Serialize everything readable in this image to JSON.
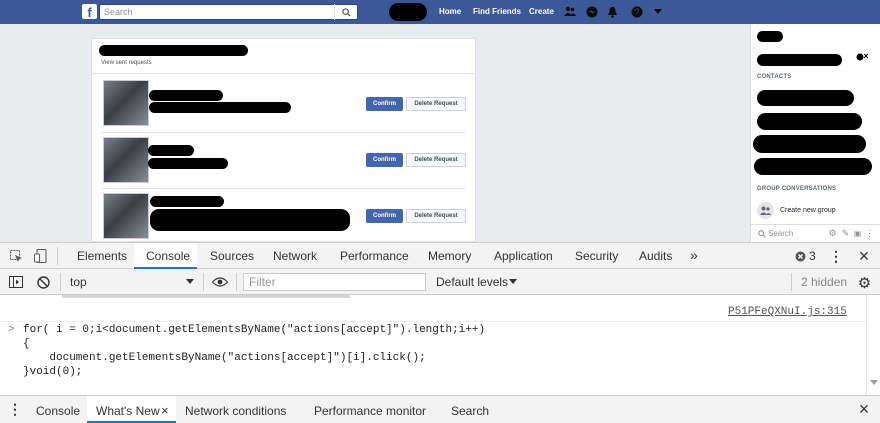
{
  "facebook": {
    "logo_letter": "f",
    "search_placeholder": "Search",
    "nav": {
      "home": "Home",
      "find_friends": "Find Friends",
      "create": "Create"
    },
    "requests": {
      "view_sent": "View sent requests",
      "items": [
        {
          "confirm_label": "Confirm",
          "delete_label": "Delete Request"
        },
        {
          "confirm_label": "Confirm",
          "delete_label": "Delete Request"
        },
        {
          "confirm_label": "Confirm",
          "delete_label": "Delete Request"
        }
      ]
    },
    "sidebar": {
      "contacts_heading": "CONTACTS",
      "group_heading": "GROUP CONVERSATIONS",
      "create_group": "Create new group",
      "search_placeholder": "Search"
    },
    "colors": {
      "brand": "#3b5998",
      "confirm": "#4267b2"
    }
  },
  "devtools": {
    "tabs": [
      "Elements",
      "Console",
      "Sources",
      "Network",
      "Performance",
      "Memory",
      "Application",
      "Security",
      "Audits"
    ],
    "active_tab": "Console",
    "more_tabs": "»",
    "error_count": "3",
    "toolbar": {
      "context": "top",
      "filter_placeholder": "Filter",
      "levels": "Default levels",
      "hidden": "2 hidden"
    },
    "console": {
      "source_link": "P51PFeQXNuI.js:315",
      "prompt": ">",
      "code": [
        "for( i = 0;i<document.getElementsByName(\"actions[accept]\").length;i++)",
        "{",
        "    document.getElementsByName(\"actions[accept]\")[i].click();",
        "}void(0);"
      ]
    },
    "drawer": {
      "tabs": [
        "Console",
        "What's New",
        "Network conditions",
        "Performance monitor",
        "Search"
      ],
      "active_tab": "What's New",
      "tab_close": "×"
    },
    "colors": {
      "accent": "#1a73e8"
    }
  }
}
